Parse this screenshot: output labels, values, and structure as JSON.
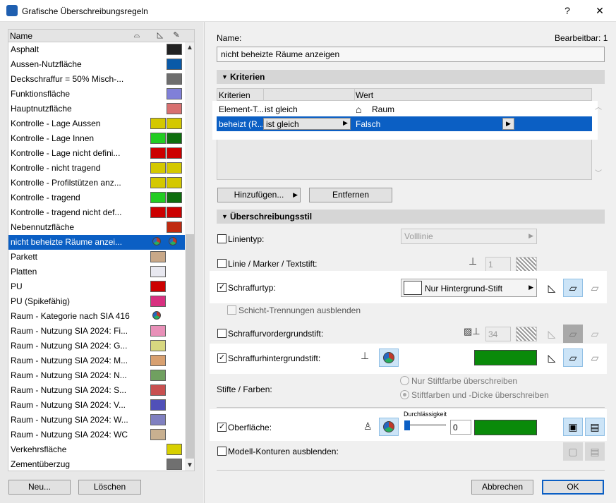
{
  "window": {
    "title": "Grafische Überschreibungsregeln",
    "help": "?",
    "close": "✕"
  },
  "list": {
    "header": "Name",
    "items": [
      {
        "label": "Asphalt",
        "c1": "",
        "c2": "#222222"
      },
      {
        "label": "Aussen-Nutzfläche",
        "c1": "",
        "c2": "#0a5aa8"
      },
      {
        "label": "Deckschraffur = 50% Misch-...",
        "c1": "",
        "c2": "#6e6e6e"
      },
      {
        "label": "Funktionsfläche",
        "c1": "",
        "c2": "#8080d8"
      },
      {
        "label": "Hauptnutzfläche",
        "c1": "",
        "c2": "#d87070"
      },
      {
        "label": "Kontrolle - Lage Aussen",
        "c1": "#d4c800",
        "c2": "#d4c800"
      },
      {
        "label": "Kontrolle - Lage Innen",
        "c1": "#22cc22",
        "c2": "#0e6e0e"
      },
      {
        "label": "Kontrolle - Lage nicht defini...",
        "c1": "#cc0000",
        "c2": "#cc0000"
      },
      {
        "label": "Kontrolle - nicht tragend",
        "c1": "#d4c800",
        "c2": "#d4c800"
      },
      {
        "label": "Kontrolle - Profilstützen anz...",
        "c1": "#d4c800",
        "c2": "#d4c800"
      },
      {
        "label": "Kontrolle - tragend",
        "c1": "#22cc22",
        "c2": "#0e6e0e"
      },
      {
        "label": "Kontrolle - tragend nicht def...",
        "c1": "#cc0000",
        "c2": "#cc0000"
      },
      {
        "label": "Nebennutzfläche",
        "c1": "",
        "c2": "#c02a10"
      },
      {
        "label": "nicht beheizte Räume anzei...",
        "c1": "pie",
        "c2": "pie",
        "selected": true
      },
      {
        "label": "Parkett",
        "c1": "#c8a888",
        "c2": ""
      },
      {
        "label": "Platten",
        "c1": "#e8e8f0",
        "c2": ""
      },
      {
        "label": "PU",
        "c1": "#cc0000",
        "c2": ""
      },
      {
        "label": "PU (Spikefähig)",
        "c1": "#d83080",
        "c2": ""
      },
      {
        "label": "Raum - Kategorie nach SIA 416",
        "c1": "pie",
        "c2": ""
      },
      {
        "label": "Raum - Nutzung SIA 2024: Fi...",
        "c1": "#e890b8",
        "c2": ""
      },
      {
        "label": "Raum - Nutzung SIA 2024: G...",
        "c1": "#d8d880",
        "c2": ""
      },
      {
        "label": "Raum - Nutzung SIA 2024: M...",
        "c1": "#d8a070",
        "c2": ""
      },
      {
        "label": "Raum - Nutzung SIA 2024: N...",
        "c1": "#70a060",
        "c2": ""
      },
      {
        "label": "Raum - Nutzung SIA 2024: S...",
        "c1": "#c85050",
        "c2": ""
      },
      {
        "label": "Raum - Nutzung SIA 2024: V...",
        "c1": "#5050b8",
        "c2": ""
      },
      {
        "label": "Raum - Nutzung SIA 2024: W...",
        "c1": "#8080c0",
        "c2": ""
      },
      {
        "label": "Raum - Nutzung SIA 2024: WC",
        "c1": "#c8b090",
        "c2": ""
      },
      {
        "label": "Verkehrsfläche",
        "c1": "",
        "c2": "#d8d000"
      },
      {
        "label": "Zementüberzug",
        "c1": "",
        "c2": "#707070"
      }
    ]
  },
  "left_buttons": {
    "new": "Neu...",
    "delete": "Löschen"
  },
  "name": {
    "label": "Name:",
    "value": "nicht beheizte Räume anzeigen",
    "editable": "Bearbeitbar: 1"
  },
  "criteria": {
    "section": "Kriterien",
    "col1": "Kriterien",
    "col3": "Wert",
    "rows": [
      {
        "c1": "Element-T...",
        "c2": "ist gleich",
        "c3": "Raum"
      },
      {
        "c1": "beheizt (R...",
        "c2": "ist gleich",
        "c3": "Falsch"
      }
    ],
    "add": "Hinzufügen...",
    "remove": "Entfernen"
  },
  "style": {
    "section": "Überschreibungsstil",
    "linetype": "Linientyp:",
    "linetype_value": "Volllinie",
    "line_pen": "Linie / Marker / Textstift:",
    "line_pen_value": "1",
    "fill_type": "Schraffurtyp:",
    "fill_type_value": "Nur Hintergrund-Stift",
    "hide_layers": "Schicht-Trennungen ausblenden",
    "fg_pen": "Schraffurvordergrundstift:",
    "fg_pen_value": "34",
    "bg_pen": "Schraffurhintergrundstift:",
    "pens_colors": "Stifte / Farben:",
    "radio1": "Nur Stiftfarbe überschreiben",
    "radio2": "Stiftfarben und -Dicke überschreiben",
    "surface": "Oberfläche:",
    "transparency": "Durchlässigkeit",
    "transparency_value": "0",
    "model_contours": "Modell-Konturen ausblenden:",
    "green": "#0a8a0a"
  },
  "footer": {
    "cancel": "Abbrechen",
    "ok": "OK"
  }
}
